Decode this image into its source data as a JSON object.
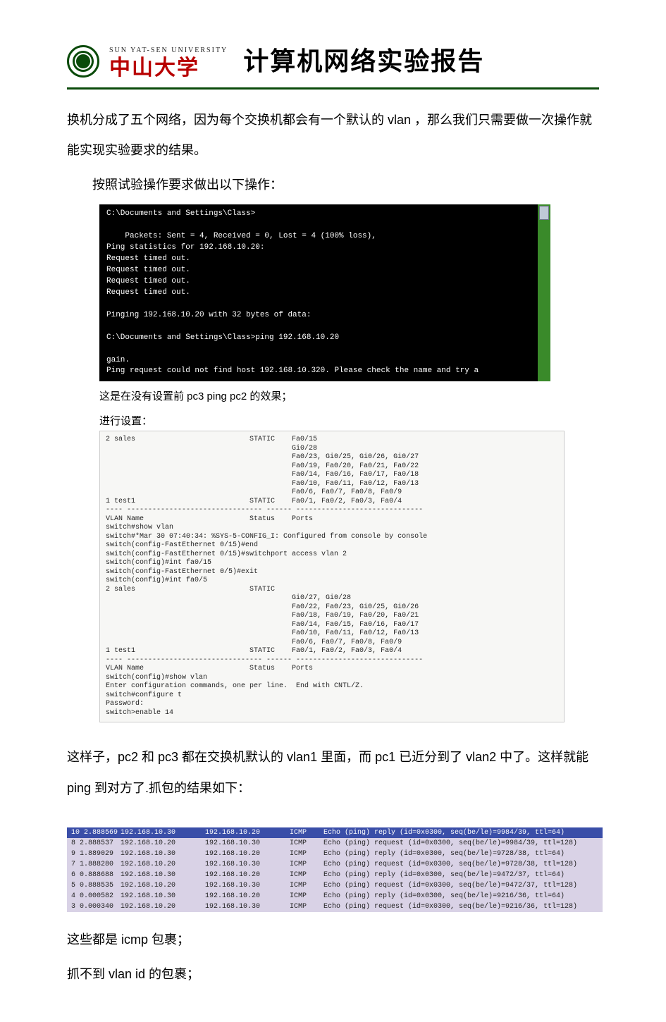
{
  "header": {
    "university_en": "SUN YAT-SEN UNIVERSITY",
    "university_cn": "中山大学",
    "report_title": "计算机网络实验报告"
  },
  "paras": {
    "p1": "换机分成了五个网络，因为每个交换机都会有一个默认的 vlan ，那么我们只需要做一次操作就能实现实验要求的结果。",
    "p2": "按照试验操作要求做出以下操作：",
    "caption1_a": "这是在没有设置前 pc3 ping pc2 的效果；",
    "caption1_b": "进行设置：",
    "p3": "这样子，pc2 和 pc3 都在交换机默认的 vlan1 里面，而 pc1 已近分到了 vlan2 中了。这样就能 ping 到对方了.抓包的结果如下：",
    "p4": "这些都是 icmp 包裹；",
    "p5": "抓不到 vlan id  的包裹；"
  },
  "terminal_lines": [
    "C:\\Documents and Settings\\Class>",
    "",
    "    Packets: Sent = 4, Received = 0, Lost = 4 (100% loss),",
    "Ping statistics for 192.168.10.20:",
    "Request timed out.",
    "Request timed out.",
    "Request timed out.",
    "Request timed out.",
    "",
    "Pinging 192.168.10.20 with 32 bytes of data:",
    "",
    "C:\\Documents and Settings\\Class>ping 192.168.10.20",
    "",
    "gain.",
    "Ping request could not find host 192.168.10.320. Please check the name and try a"
  ],
  "vlan_lines": [
    "2 sales                           STATIC    Fa0/15",
    "                                            Gi0/28",
    "                                            Fa0/23, Gi0/25, Gi0/26, Gi0/27",
    "                                            Fa0/19, Fa0/20, Fa0/21, Fa0/22",
    "                                            Fa0/14, Fa0/16, Fa0/17, Fa0/18",
    "                                            Fa0/10, Fa0/11, Fa0/12, Fa0/13",
    "                                            Fa0/6, Fa0/7, Fa0/8, Fa0/9",
    "1 test1                           STATIC    Fa0/1, Fa0/2, Fa0/3, Fa0/4",
    "---- -------------------------------- ------ ------------------------------",
    "VLAN Name                         Status    Ports",
    "switch#show vlan",
    "switch#*Mar 30 07:40:34: %SYS-5-CONFIG_I: Configured from console by console",
    "switch(config-FastEthernet 0/15)#end",
    "switch(config-FastEthernet 0/15)#switchport access vlan 2",
    "switch(config)#int fa0/15",
    "switch(config-FastEthernet 0/5)#exit",
    "switch(config)#int fa0/5",
    "2 sales                           STATIC",
    "                                            Gi0/27, Gi0/28",
    "                                            Fa0/22, Fa0/23, Gi0/25, Gi0/26",
    "                                            Fa0/18, Fa0/19, Fa0/20, Fa0/21",
    "                                            Fa0/14, Fa0/15, Fa0/16, Fa0/17",
    "                                            Fa0/10, Fa0/11, Fa0/12, Fa0/13",
    "                                            Fa0/6, Fa0/7, Fa0/8, Fa0/9",
    "1 test1                           STATIC    Fa0/1, Fa0/2, Fa0/3, Fa0/4",
    "---- -------------------------------- ------ ------------------------------",
    "VLAN Name                         Status    Ports",
    "switch(config)#show vlan",
    "Enter configuration commands, one per line.  End with CNTL/Z.",
    "switch#configure t",
    "Password:",
    "switch>enable 14"
  ],
  "packets": [
    {
      "no": "10 2.888569",
      "src": "192.168.10.30",
      "dst": "192.168.10.20",
      "proto": "ICMP",
      "info": "Echo (ping) reply    (id=0x0300, seq(be/le)=9984/39, ttl=64)",
      "sel": true
    },
    {
      "no": " 8 2.888537",
      "src": "192.168.10.20",
      "dst": "192.168.10.30",
      "proto": "ICMP",
      "info": "Echo (ping) request  (id=0x0300, seq(be/le)=9984/39, ttl=128)",
      "sel": false
    },
    {
      "no": " 9 1.889029",
      "src": "192.168.10.30",
      "dst": "192.168.10.20",
      "proto": "ICMP",
      "info": "Echo (ping) reply    (id=0x0300, seq(be/le)=9728/38, ttl=64)",
      "sel": false
    },
    {
      "no": " 7 1.888280",
      "src": "192.168.10.20",
      "dst": "192.168.10.30",
      "proto": "ICMP",
      "info": "Echo (ping) request  (id=0x0300, seq(be/le)=9728/38, ttl=128)",
      "sel": false
    },
    {
      "no": " 6 0.888688",
      "src": "192.168.10.30",
      "dst": "192.168.10.20",
      "proto": "ICMP",
      "info": "Echo (ping) reply    (id=0x0300, seq(be/le)=9472/37, ttl=64)",
      "sel": false
    },
    {
      "no": " 5 0.888535",
      "src": "192.168.10.20",
      "dst": "192.168.10.30",
      "proto": "ICMP",
      "info": "Echo (ping) request  (id=0x0300, seq(be/le)=9472/37, ttl=128)",
      "sel": false
    },
    {
      "no": " 4 0.000582",
      "src": "192.168.10.30",
      "dst": "192.168.10.20",
      "proto": "ICMP",
      "info": "Echo (ping) reply    (id=0x0300, seq(be/le)=9216/36, ttl=64)",
      "sel": false
    },
    {
      "no": " 3 0.000340",
      "src": "192.168.10.20",
      "dst": "192.168.10.30",
      "proto": "ICMP",
      "info": "Echo (ping) request  (id=0x0300, seq(be/le)=9216/36, ttl=128)",
      "sel": false
    }
  ]
}
